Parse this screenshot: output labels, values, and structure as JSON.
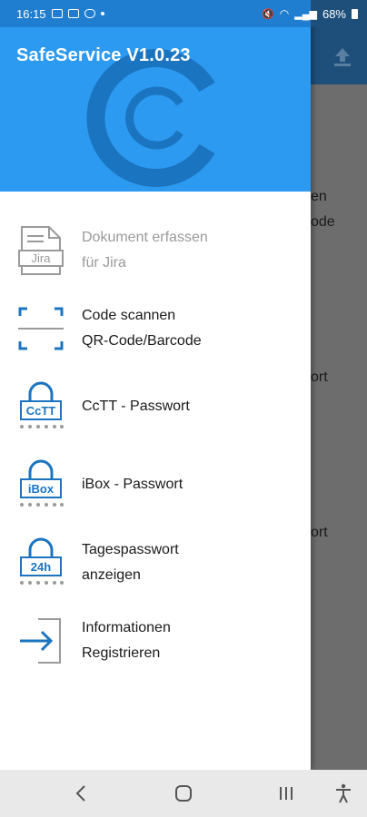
{
  "status_bar": {
    "time": "16:15",
    "battery": "68%"
  },
  "drawer": {
    "title": "SafeService V1.0.23",
    "items": [
      {
        "line1": "Dokument erfassen",
        "line2": "für Jira",
        "icon": "jira-document-icon",
        "icon_text": "Jira",
        "enabled": false
      },
      {
        "line1": "Code scannen",
        "line2": "QR-Code/Barcode",
        "icon": "scan-frame-icon",
        "enabled": true
      },
      {
        "line1": "CcTT - Passwort",
        "line2": "",
        "icon": "lock-password-icon",
        "icon_text": "CcTT",
        "enabled": true
      },
      {
        "line1": "iBox - Passwort",
        "line2": "",
        "icon": "lock-password-icon",
        "icon_text": "iBox",
        "enabled": true
      },
      {
        "line1": "Tagespasswort",
        "line2": "anzeigen",
        "icon": "lock-password-icon",
        "icon_text": "24h",
        "enabled": true
      },
      {
        "line1": "Informationen",
        "line2": "Registrieren",
        "icon": "login-arrow-icon",
        "enabled": true
      }
    ]
  },
  "background": {
    "snippets": [
      "en",
      "ode",
      "ort",
      "ort"
    ]
  },
  "colors": {
    "header": "#2c9af0",
    "icon_blue": "#1b74c0",
    "status_bar": "#1f7ed0"
  }
}
